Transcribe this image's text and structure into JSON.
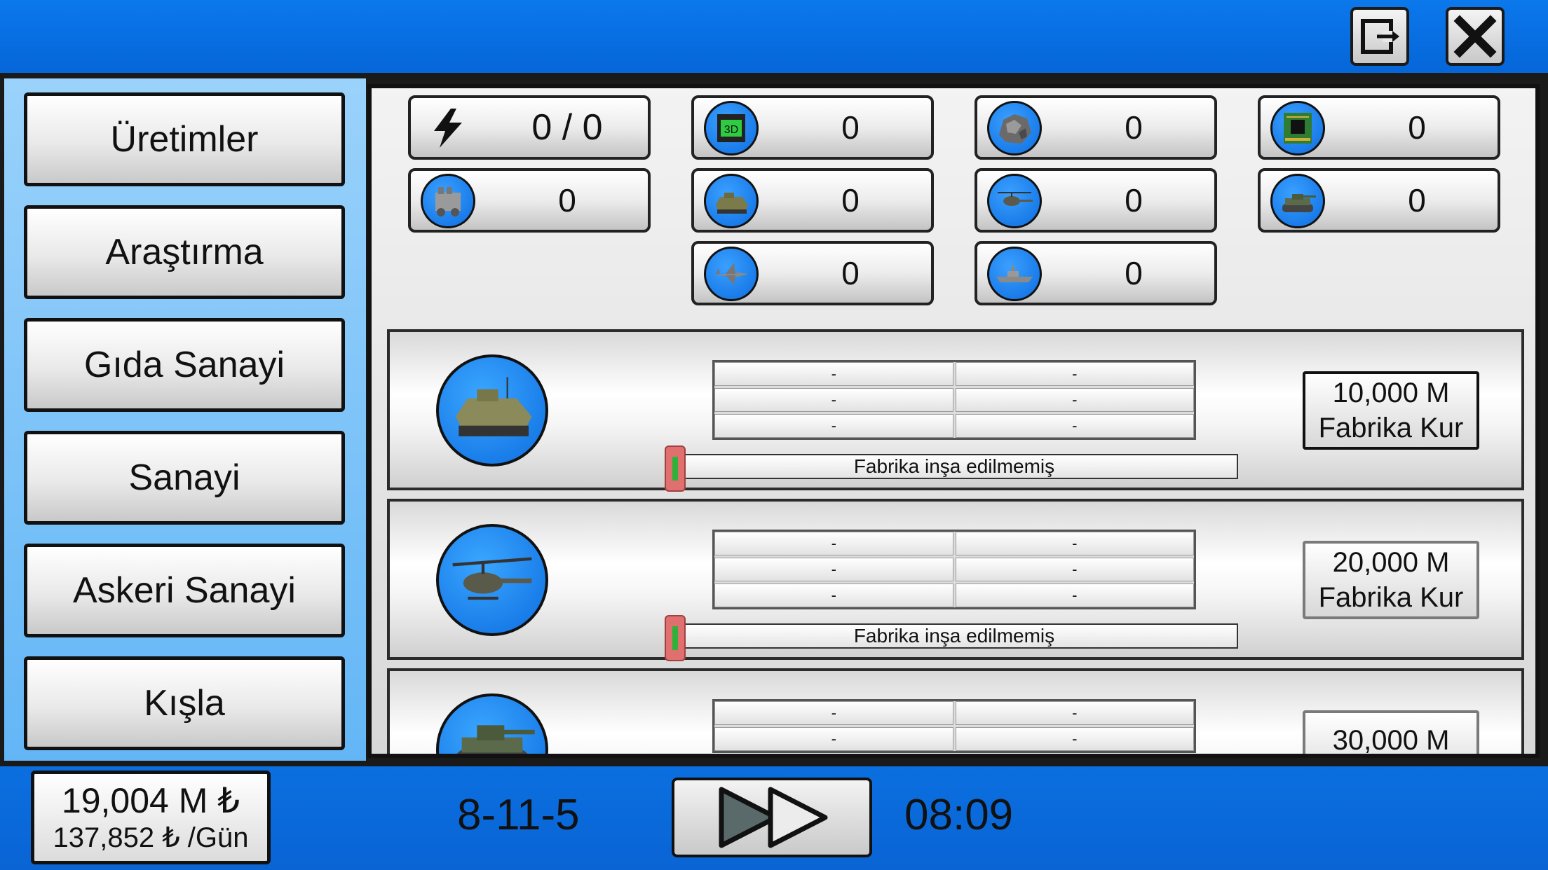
{
  "top_buttons": {
    "exit_icon": "exit-icon",
    "close_icon": "close-icon"
  },
  "sidebar": {
    "items": [
      {
        "label": "Üretimler"
      },
      {
        "label": "Araştırma"
      },
      {
        "label": "Gıda Sanayi"
      },
      {
        "label": "Sanayi"
      },
      {
        "label": "Askeri Sanayi"
      },
      {
        "label": "Kışla"
      }
    ]
  },
  "resources": [
    {
      "icon": "lightning-icon",
      "value": "0 / 0"
    },
    {
      "icon": "3d-printer-icon",
      "value": "0"
    },
    {
      "icon": "metal-ore-icon",
      "value": "0"
    },
    {
      "icon": "circuit-board-icon",
      "value": "0"
    },
    {
      "icon": "engine-icon",
      "value": "0"
    },
    {
      "icon": "apc-icon",
      "value": "0"
    },
    {
      "icon": "helicopter-icon",
      "value": "0"
    },
    {
      "icon": "tank-icon",
      "value": "0"
    },
    {
      "icon": "fighter-jet-icon",
      "value": "0"
    },
    {
      "icon": "warship-icon",
      "value": "0"
    }
  ],
  "factories": [
    {
      "icon": "apc-icon",
      "cells": [
        "-",
        "-",
        "-",
        "-",
        "-",
        "-"
      ],
      "status": "Fabrika inşa edilmemiş",
      "progress": 0,
      "price": "10,000 M",
      "action": "Fabrika Kur",
      "enabled": true
    },
    {
      "icon": "helicopter-icon",
      "cells": [
        "-",
        "-",
        "-",
        "-",
        "-",
        "-"
      ],
      "status": "Fabrika inşa edilmemiş",
      "progress": 0,
      "price": "20,000 M",
      "action": "Fabrika Kur",
      "enabled": false
    },
    {
      "icon": "tank-icon",
      "cells": [
        "-",
        "-",
        "-",
        "-"
      ],
      "price": "30,000 M",
      "enabled": false
    }
  ],
  "footer": {
    "money": "19,004 M ₺",
    "income": "137,852 ₺ /Gün",
    "date": "8-11-5",
    "time": "08:09",
    "speed_icon": "fast-forward-icon"
  }
}
